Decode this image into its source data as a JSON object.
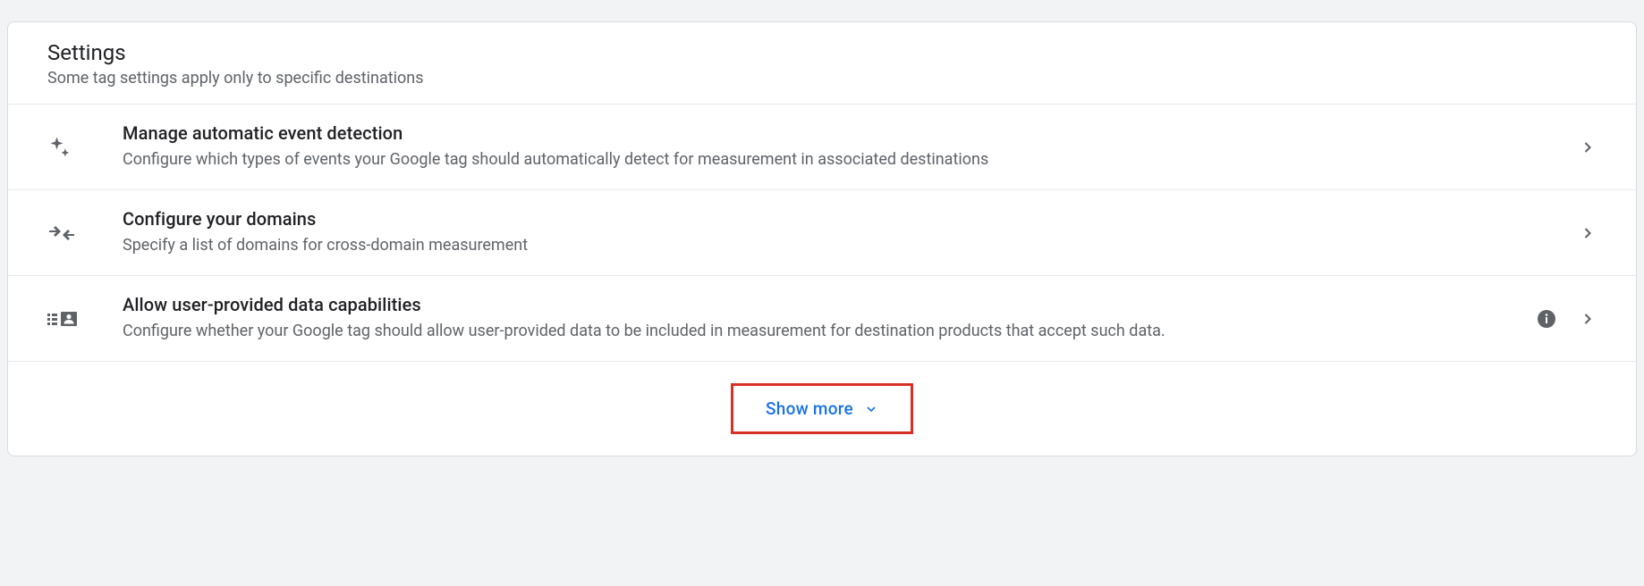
{
  "header": {
    "title": "Settings",
    "subtitle": "Some tag settings apply only to specific destinations"
  },
  "settings": [
    {
      "title": "Manage automatic event detection",
      "description": "Configure which types of events your Google tag should automatically detect for measurement in associated destinations",
      "has_info": false
    },
    {
      "title": "Configure your domains",
      "description": "Specify a list of domains for cross-domain measurement",
      "has_info": false
    },
    {
      "title": "Allow user-provided data capabilities",
      "description": "Configure whether your Google tag should allow user-provided data to be included in measurement for destination products that accept such data.",
      "has_info": true
    }
  ],
  "show_more_label": "Show more"
}
